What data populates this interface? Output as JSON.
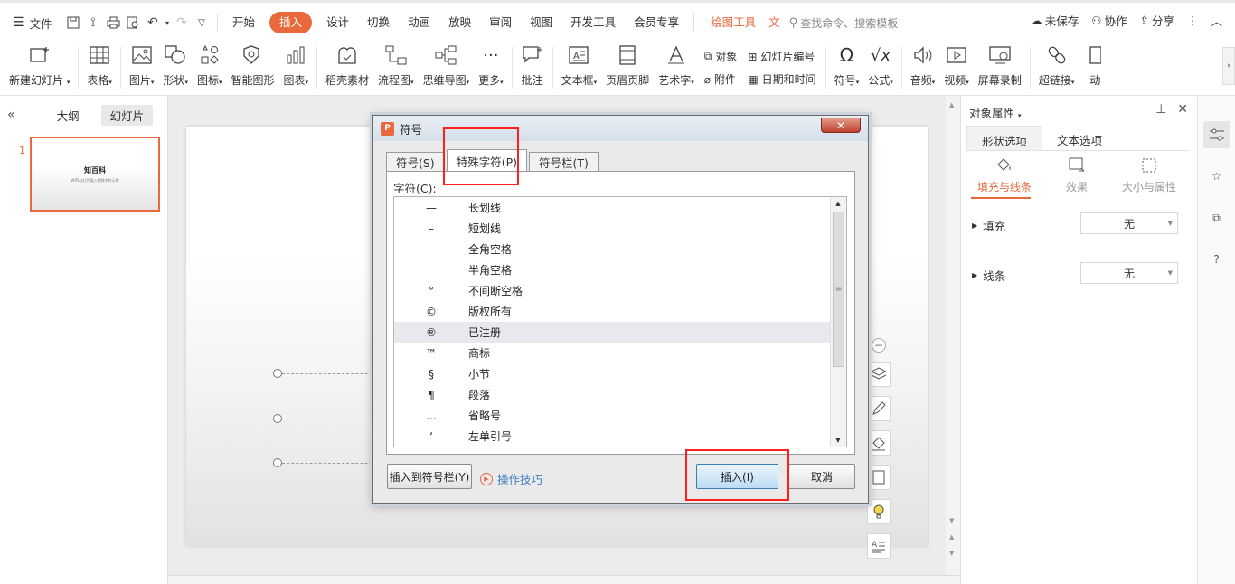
{
  "menu": {
    "file": "文件",
    "tabs": [
      "开始",
      "插入",
      "设计",
      "切换",
      "动画",
      "放映",
      "审阅",
      "视图",
      "开发工具",
      "会员专享"
    ],
    "active_tab": "插入",
    "drawing_tools": "绘图工具",
    "truncated_tab": "文",
    "search_placeholder": "查找命令、搜索模板",
    "unsaved": "未保存",
    "collab": "协作",
    "share": "分享"
  },
  "ribbon": {
    "new_slide": "新建幻灯片",
    "table": "表格",
    "picture": "图片",
    "shape": "形状",
    "icon": "图标",
    "smart_shape": "智能图形",
    "chart": "图表",
    "material": "稻壳素材",
    "flowchart": "流程图",
    "mindmap": "思维导图",
    "more": "更多",
    "comment": "批注",
    "textbox": "文本框",
    "header_footer": "页眉页脚",
    "wordart": "艺术字",
    "object": "对象",
    "attachment": "附件",
    "slide_number": "幻灯片编号",
    "datetime": "日期和时间",
    "symbol": "符号",
    "formula": "公式",
    "audio": "音频",
    "video": "视频",
    "screen_record": "屏幕录制",
    "hyperlink": "超链接",
    "animation_trunc": "动"
  },
  "left_panel": {
    "outline": "大纲",
    "slides": "幻灯片",
    "slide_number": "1",
    "thumb_title": "知百科",
    "thumb_subtitle": "WPS幻灯片插入特殊字符示例"
  },
  "right_panel": {
    "title": "对象属性",
    "tab_shape": "形状选项",
    "tab_text": "文本选项",
    "sub_fill_line": "填充与线条",
    "sub_effect": "效果",
    "sub_size": "大小与属性",
    "fill_label": "填充",
    "fill_value": "无",
    "line_label": "线条",
    "line_value": "无"
  },
  "dialog": {
    "title": "符号",
    "tab_symbol": "符号(S)",
    "tab_special": "特殊字符(P)",
    "tab_symbolbar": "符号栏(T)",
    "char_label": "字符(C):",
    "items": [
      {
        "sym": "—",
        "name": "长划线"
      },
      {
        "sym": "–",
        "name": "短划线"
      },
      {
        "sym": "",
        "name": "全角空格"
      },
      {
        "sym": "",
        "name": "半角空格"
      },
      {
        "sym": "°",
        "name": "不间断空格"
      },
      {
        "sym": "©",
        "name": "版权所有"
      },
      {
        "sym": "®",
        "name": "已注册"
      },
      {
        "sym": "™",
        "name": "商标"
      },
      {
        "sym": "§",
        "name": "小节"
      },
      {
        "sym": "¶",
        "name": "段落"
      },
      {
        "sym": "…",
        "name": "省略号"
      },
      {
        "sym": "‘",
        "name": "左单引号"
      }
    ],
    "selected_index": 6,
    "insert_to_bar": "插入到符号栏(Y)",
    "tips": "操作技巧",
    "insert": "插入(I)",
    "cancel": "取消"
  },
  "colors": {
    "accent": "#e9683c",
    "annotation_red": "#ff1f1f"
  }
}
